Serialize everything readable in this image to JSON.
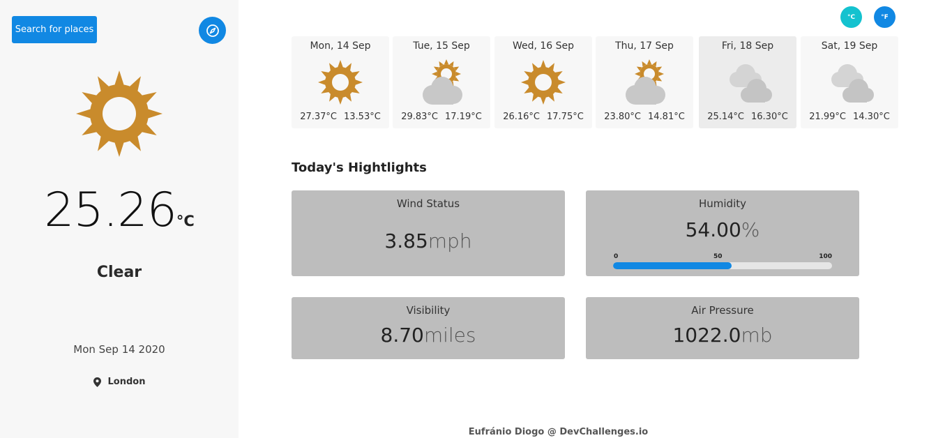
{
  "sidebar": {
    "search_label": "Search for places",
    "current": {
      "temperature": "25.26",
      "unit": "°C",
      "condition": "Clear",
      "date": "Mon Sep 14 2020",
      "location": "London",
      "icon": "sun-icon"
    }
  },
  "units": {
    "celsius": "°C",
    "fahrenheit": "°F"
  },
  "forecast": [
    {
      "day": "Mon, 14 Sep",
      "max": "27.37°C",
      "min": "13.53°C",
      "icon": "sun-icon"
    },
    {
      "day": "Tue, 15 Sep",
      "max": "29.83°C",
      "min": "17.19°C",
      "icon": "partly-cloudy-icon"
    },
    {
      "day": "Wed, 16 Sep",
      "max": "26.16°C",
      "min": "17.75°C",
      "icon": "sun-icon"
    },
    {
      "day": "Thu, 17 Sep",
      "max": "23.80°C",
      "min": "14.81°C",
      "icon": "partly-cloudy-icon"
    },
    {
      "day": "Fri, 18 Sep",
      "max": "25.14°C",
      "min": "16.30°C",
      "icon": "cloudy-icon"
    },
    {
      "day": "Sat, 19 Sep",
      "max": "21.99°C",
      "min": "14.30°C",
      "icon": "cloudy-icon"
    }
  ],
  "highlights": {
    "title": "Today's Hightlights",
    "wind": {
      "label": "Wind Status",
      "value": "3.85",
      "unit": "mph"
    },
    "humidity": {
      "label": "Humidity",
      "value": "54.00",
      "unit": "%",
      "percent": 54,
      "scale": [
        "0",
        "50",
        "100"
      ]
    },
    "visibility": {
      "label": "Visibility",
      "value": "8.70",
      "unit": "miles"
    },
    "pressure": {
      "label": "Air Pressure",
      "value": "1022.0",
      "unit": "mb"
    }
  },
  "footer": "Eufránio Diogo @ DevChallenges.io",
  "colors": {
    "accent": "#1188e3",
    "celsius_active": "#14c2cf",
    "sun": "#c98b2c",
    "cloud": "#c8c8c8",
    "card_bg": "#bdbdbd"
  }
}
